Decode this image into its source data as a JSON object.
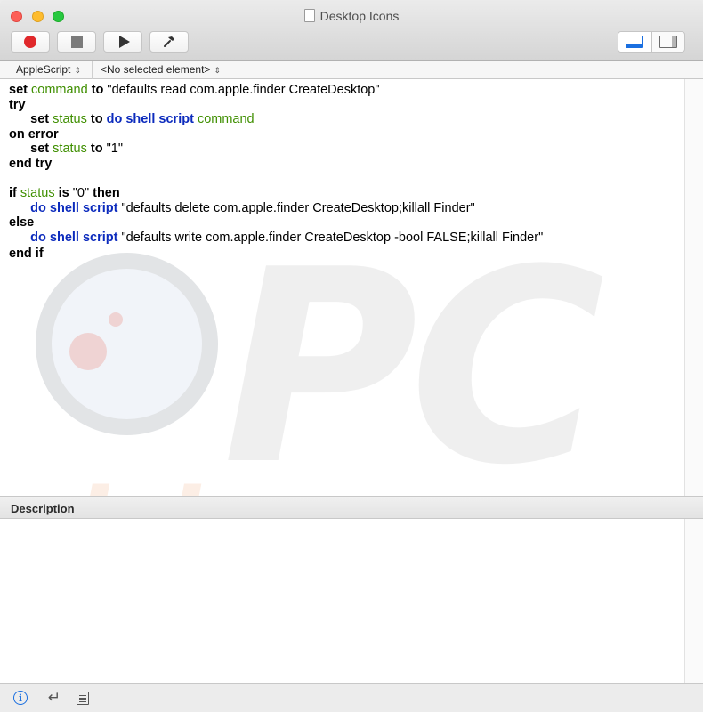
{
  "window": {
    "title": "Desktop Icons"
  },
  "toolbar": {
    "record": "record-icon",
    "stop": "stop-icon",
    "run": "run-icon",
    "compile": "hammer-icon",
    "view_bottom": "bottom-panel-icon",
    "view_side": "side-panel-icon"
  },
  "navbar": {
    "language": "AppleScript",
    "element": "<No selected element>"
  },
  "editor": {
    "lines": [
      [
        [
          "kw",
          "set "
        ],
        [
          "var",
          "command"
        ],
        [
          "kw",
          " to "
        ],
        [
          "str",
          "\"defaults read com.apple.finder CreateDesktop\""
        ]
      ],
      [
        [
          "kw",
          "try"
        ]
      ],
      [
        [
          "str",
          "      "
        ],
        [
          "kw",
          "set "
        ],
        [
          "var",
          "status"
        ],
        [
          "kw",
          " to "
        ],
        [
          "app",
          "do shell script "
        ],
        [
          "var",
          "command"
        ]
      ],
      [
        [
          "kw",
          "on error"
        ]
      ],
      [
        [
          "str",
          "      "
        ],
        [
          "kw",
          "set "
        ],
        [
          "var",
          "status"
        ],
        [
          "kw",
          " to "
        ],
        [
          "str",
          "\"1\""
        ]
      ],
      [
        [
          "kw",
          "end try"
        ]
      ],
      [],
      [
        [
          "kw",
          "if "
        ],
        [
          "var",
          "status"
        ],
        [
          "kw",
          " is "
        ],
        [
          "str",
          "\"0\" "
        ],
        [
          "kw",
          "then"
        ]
      ],
      [
        [
          "str",
          "      "
        ],
        [
          "app",
          "do shell script "
        ],
        [
          "str",
          "\"defaults delete com.apple.finder CreateDesktop;killall Finder\""
        ]
      ],
      [
        [
          "kw",
          "else"
        ]
      ],
      [
        [
          "str",
          "      "
        ],
        [
          "app",
          "do shell script "
        ],
        [
          "str",
          "\"defaults write com.apple.finder CreateDesktop -bool FALSE;killall Finder\""
        ]
      ],
      [
        [
          "kw",
          "end if"
        ],
        [
          "cursor",
          ""
        ]
      ]
    ]
  },
  "watermark": {
    "logo": "PC",
    "text": "risk.com"
  },
  "description": {
    "label": "Description"
  },
  "bottombar": {
    "info": "info-icon",
    "return": "return-icon",
    "log": "log-icon",
    "info_glyph": "i",
    "return_glyph": "↵"
  }
}
